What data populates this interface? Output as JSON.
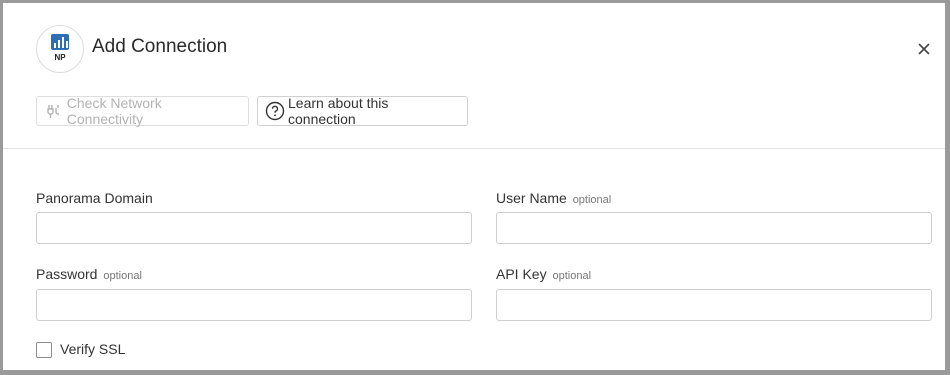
{
  "dialog": {
    "title": "Add Connection",
    "logo_text": "NP",
    "icons": {
      "logo": "network-logo-icon",
      "close": "close-icon"
    }
  },
  "actions": {
    "check_network": {
      "label": "Check Network Connectivity",
      "icon": "plug-icon",
      "disabled": true
    },
    "learn": {
      "label": "Learn about this connection",
      "icon": "help-circle-icon"
    }
  },
  "form": {
    "panorama_domain": {
      "label": "Panorama Domain",
      "optional": "",
      "value": ""
    },
    "user_name": {
      "label": "User Name",
      "optional": "optional",
      "value": ""
    },
    "password": {
      "label": "Password",
      "optional": "optional",
      "value": ""
    },
    "api_key": {
      "label": "API Key",
      "optional": "optional",
      "value": ""
    },
    "verify_ssl": {
      "label": "Verify SSL",
      "checked": false
    }
  },
  "colors": {
    "border": "#cfcfcf",
    "text": "#333333",
    "muted": "#777777",
    "disabled": "#b3b3b3",
    "logo_accent": "#2f6db5"
  }
}
